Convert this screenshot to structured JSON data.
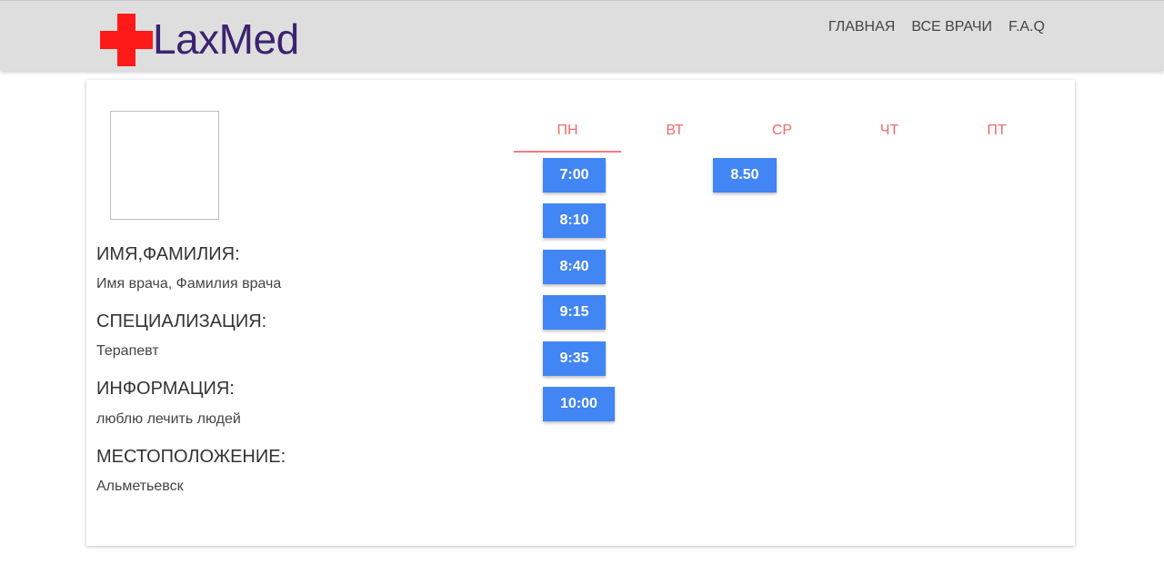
{
  "header": {
    "logo_text": "LaxMed",
    "nav": [
      "ГЛАВНАЯ",
      "ВСЕ ВРАЧИ",
      "F.A.Q"
    ]
  },
  "doctor": {
    "name_label": "ИМЯ,ФАМИЛИЯ:",
    "name_value": "Имя врача, Фамилия врача",
    "spec_label": "СПЕЦИАЛИЗАЦИЯ:",
    "spec_value": "Терапевт",
    "info_label": "ИНФОРМАЦИЯ:",
    "info_value": "люблю лечить людей",
    "location_label": "МЕСТОПОЛОЖЕНИЕ:",
    "location_value": "Альметьевск"
  },
  "schedule": {
    "days": [
      "ПН",
      "ВТ",
      "СР",
      "ЧТ",
      "ПТ"
    ],
    "selected_day": "ПН",
    "monday_slots": [
      "7:00",
      "8:10",
      "8:40",
      "9:15",
      "9:35",
      "10:00"
    ],
    "wednesday_slot": "8.50"
  },
  "colors": {
    "header_bg": "#dedede",
    "logo_cross": "#ff1a1a",
    "logo_text": "#3b2370",
    "day_tab": "#ef6a6a",
    "slot_bg": "#4285f4"
  }
}
